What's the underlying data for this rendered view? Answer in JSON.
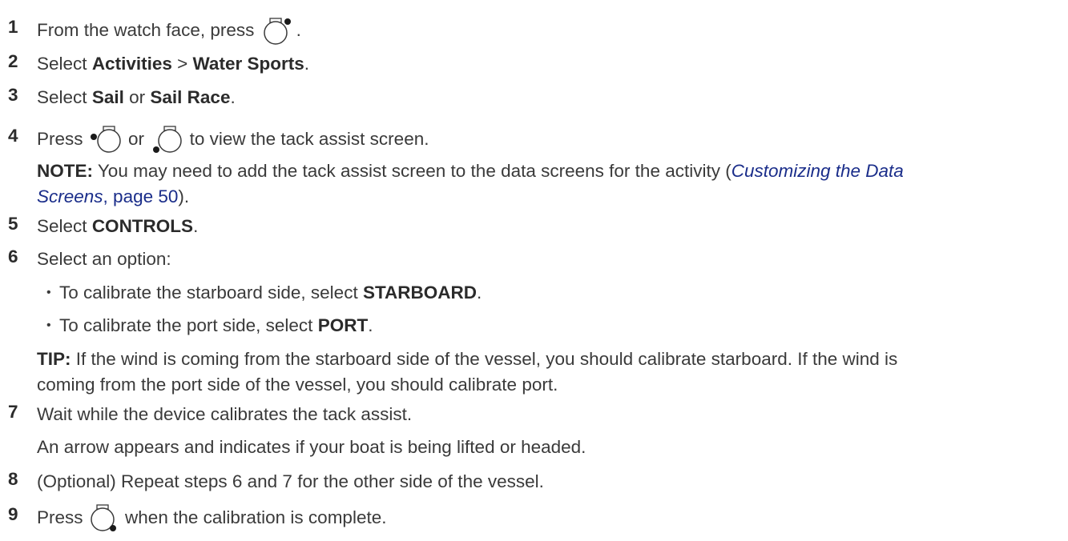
{
  "steps": [
    {
      "number": "1",
      "text_before": "From the watch face, press",
      "icon": "button-top-right-icon",
      "text_after": "."
    },
    {
      "number": "2",
      "prefix": "Select",
      "bold1": "Activities",
      "sep": ">",
      "bold2": "Water Sports",
      "suffix": "."
    },
    {
      "number": "3",
      "prefix": "Select",
      "bold1": "Sail",
      "mid": "or",
      "bold2": "Sail Race",
      "suffix": "."
    },
    {
      "number": "4",
      "prefix": "Press",
      "icon1": "button-left-upper-icon",
      "mid": "or",
      "icon2": "button-left-lower-icon",
      "suffix": "to view the tack assist screen."
    },
    {
      "number": "5",
      "prefix": "Select",
      "bold1": "CONTROLS",
      "suffix": "."
    },
    {
      "number": "6",
      "text": "Select an option:"
    },
    {
      "number": "7",
      "text": "Wait while the device calibrates the tack assist."
    },
    {
      "number": "8",
      "text": "(Optional) Repeat steps 6 and 7 for the other side of the vessel."
    },
    {
      "number": "9",
      "prefix": "Press",
      "icon": "button-bottom-right-icon",
      "suffix": "when the calibration is complete."
    }
  ],
  "note": {
    "label": "NOTE:",
    "text_before": "You may need to add the tack assist screen to the data screens for the activity (",
    "link_italic_line1": "Customizing the Data",
    "link_italic_line2": "Screens",
    "link_page": ", page 50",
    "text_after": ")."
  },
  "options": [
    {
      "prefix": "To calibrate the starboard side, select",
      "bold": "STARBOARD",
      "suffix": "."
    },
    {
      "prefix": "To calibrate the port side, select",
      "bold": "PORT",
      "suffix": "."
    }
  ],
  "tip": {
    "label": "TIP:",
    "line1": "If the wind is coming from the starboard side of the vessel, you should calibrate starboard. If the wind is",
    "line2": "coming from the port side of the vessel, you should calibrate port."
  },
  "step7_result": "An arrow appears and indicates if your boat is being lifted or headed.",
  "bullet_char": "•"
}
